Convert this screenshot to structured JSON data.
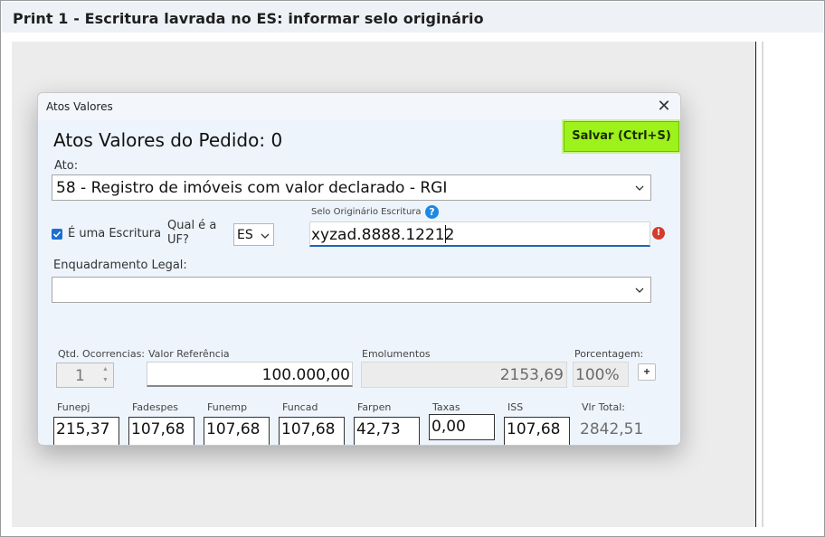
{
  "page": {
    "title": "Print 1 - Escritura lavrada no ES: informar selo originário"
  },
  "dialog": {
    "title": "Atos Valores",
    "heading": "Atos Valores do Pedido: 0",
    "save_label": "Salvar (Ctrl+S)",
    "ato": {
      "label": "Ato:",
      "value": "58 - Registro de imóveis com valor declarado - RGI"
    },
    "escritura": {
      "label": "É uma Escritura",
      "checked": true
    },
    "uf": {
      "label_line1": "Qual é a",
      "label_line2": "UF?",
      "value": "ES"
    },
    "selo": {
      "label": "Selo Originário Escritura",
      "value": "xyzad.8888.12212",
      "help_icon": "help-icon",
      "error_icon": "error-icon"
    },
    "enquadramento": {
      "label": "Enquadramento Legal:",
      "value": ""
    },
    "qtd": {
      "label": "Qtd. Ocorrencias:",
      "value": "1"
    },
    "valor_ref": {
      "label": "Valor Referência",
      "value": "100.000,00"
    },
    "emolumentos": {
      "label": "Emolumentos",
      "value": "2153,69"
    },
    "porcentagem": {
      "label": "Porcentagem:",
      "value": "100%",
      "add_label": "+"
    },
    "fees": [
      {
        "label": "Funepj",
        "value": "215,37"
      },
      {
        "label": "Fadespes",
        "value": "107,68"
      },
      {
        "label": "Funemp",
        "value": "107,68"
      },
      {
        "label": "Funcad",
        "value": "107,68"
      },
      {
        "label": "Farpen",
        "value": "42,73"
      },
      {
        "label": "Taxas",
        "value": "0,00"
      },
      {
        "label": "ISS",
        "value": "107,68"
      }
    ],
    "total": {
      "label": "Vlr Total:",
      "value": "2842,51"
    }
  },
  "colors": {
    "save_button": "#9cf21a",
    "accent": "#1f64b4",
    "error": "#d73b2b",
    "checkbox": "#1d6fd1"
  }
}
